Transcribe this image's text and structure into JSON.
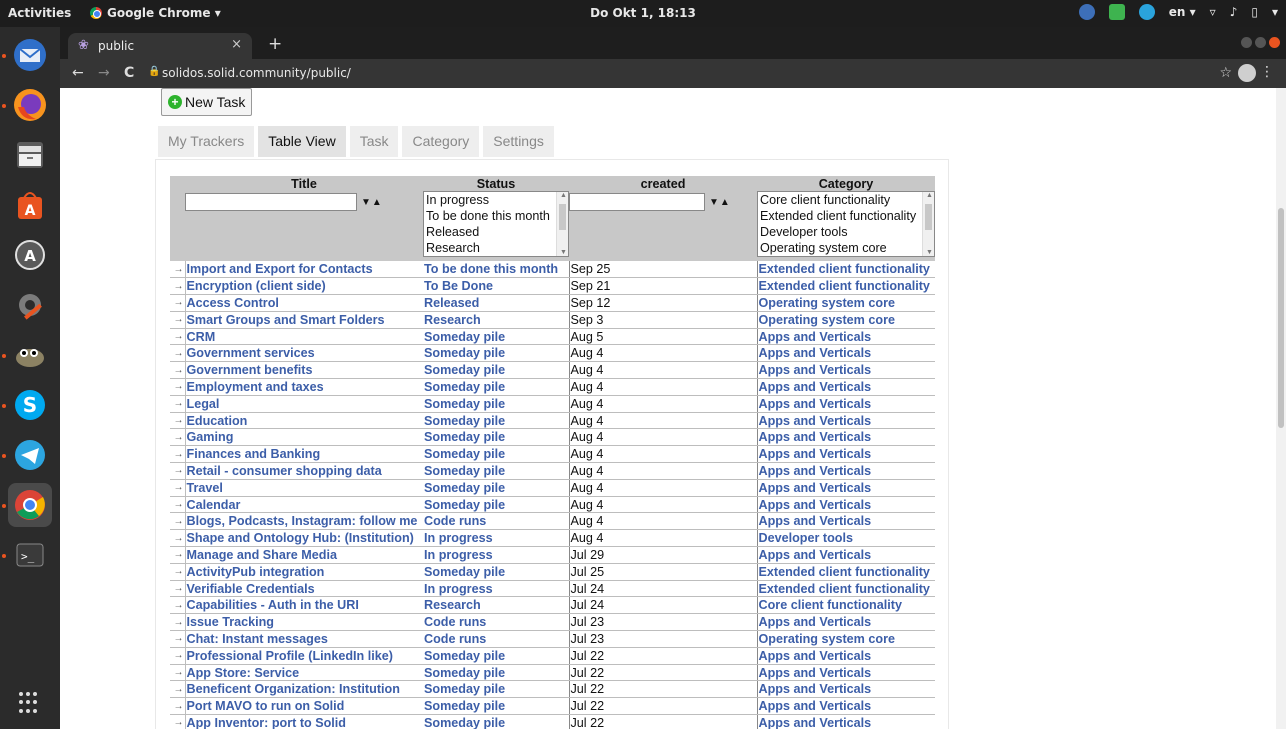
{
  "system": {
    "activities": "Activities",
    "app_menu": "Google Chrome ▾",
    "clock": "Do Okt  1, 18:13",
    "lang": "en ▾"
  },
  "browser": {
    "tab_title": "public",
    "tab_close": "×",
    "new_tab": "+",
    "url_host": "solidos.solid.community",
    "url_path": "/public/",
    "back": "←",
    "forward": "→",
    "reload": "C",
    "star": "☆",
    "menu": "⋮"
  },
  "page": {
    "new_task_label": "New Task",
    "tabs": [
      {
        "label": "My Trackers",
        "selected": false
      },
      {
        "label": "Table View",
        "selected": true
      },
      {
        "label": "Task",
        "selected": false
      },
      {
        "label": "Category",
        "selected": false
      },
      {
        "label": "Settings",
        "selected": false
      }
    ],
    "table": {
      "headers": [
        "Title",
        "Status",
        "created",
        "Category"
      ],
      "sort_arrows": "▼▲",
      "status_options": [
        "In progress",
        "To be done this month",
        "Released",
        "Research"
      ],
      "category_options": [
        "Core client functionality",
        "Extended client functionality",
        "Developer tools",
        "Operating system core"
      ],
      "row_arrow": "→",
      "rows": [
        {
          "title": "Import and Export for Contacts",
          "status": "To be done this month",
          "created": "Sep 25",
          "category": "Extended client functionality"
        },
        {
          "title": "Encryption (client side)",
          "status": "To Be Done",
          "created": "Sep 21",
          "category": "Extended client functionality"
        },
        {
          "title": "Access Control",
          "status": "Released",
          "created": "Sep 12",
          "category": "Operating system core"
        },
        {
          "title": "Smart Groups and Smart Folders",
          "status": "Research",
          "created": "Sep 3",
          "category": "Operating system core"
        },
        {
          "title": "CRM",
          "status": "Someday pile",
          "created": "Aug 5",
          "category": "Apps and Verticals"
        },
        {
          "title": "Government services",
          "status": "Someday pile",
          "created": "Aug 4",
          "category": "Apps and Verticals"
        },
        {
          "title": "Government benefits",
          "status": "Someday pile",
          "created": "Aug 4",
          "category": "Apps and Verticals"
        },
        {
          "title": "Employment and taxes",
          "status": "Someday pile",
          "created": "Aug 4",
          "category": "Apps and Verticals"
        },
        {
          "title": "Legal",
          "status": "Someday pile",
          "created": "Aug 4",
          "category": "Apps and Verticals"
        },
        {
          "title": "Education",
          "status": "Someday pile",
          "created": "Aug 4",
          "category": "Apps and Verticals"
        },
        {
          "title": "Gaming",
          "status": "Someday pile",
          "created": "Aug 4",
          "category": "Apps and Verticals"
        },
        {
          "title": "Finances and Banking",
          "status": "Someday pile",
          "created": "Aug 4",
          "category": "Apps and Verticals"
        },
        {
          "title": "Retail - consumer shopping data",
          "status": "Someday pile",
          "created": "Aug 4",
          "category": "Apps and Verticals"
        },
        {
          "title": "Travel",
          "status": "Someday pile",
          "created": "Aug 4",
          "category": "Apps and Verticals"
        },
        {
          "title": "Calendar",
          "status": "Someday pile",
          "created": "Aug 4",
          "category": "Apps and Verticals"
        },
        {
          "title": "Blogs, Podcasts, Instagram: follow me",
          "status": "Code runs",
          "created": "Aug 4",
          "category": "Apps and Verticals"
        },
        {
          "title": "Shape and Ontology Hub: (Institution)",
          "status": "In progress",
          "created": "Aug 4",
          "category": "Developer tools"
        },
        {
          "title": "Manage and Share Media",
          "status": "In progress",
          "created": "Jul 29",
          "category": "Apps and Verticals"
        },
        {
          "title": "ActivityPub integration",
          "status": "Someday pile",
          "created": "Jul 25",
          "category": "Extended client functionality"
        },
        {
          "title": "Verifiable Credentials",
          "status": "In progress",
          "created": "Jul 24",
          "category": "Extended client functionality"
        },
        {
          "title": "Capabilities - Auth in the URI",
          "status": "Research",
          "created": "Jul 24",
          "category": "Core client functionality"
        },
        {
          "title": "Issue Tracking",
          "status": "Code runs",
          "created": "Jul 23",
          "category": "Apps and Verticals"
        },
        {
          "title": "Chat: Instant messages",
          "status": "Code runs",
          "created": "Jul 23",
          "category": "Operating system core"
        },
        {
          "title": "Professional Profile (LinkedIn like)",
          "status": "Someday pile",
          "created": "Jul 22",
          "category": "Apps and Verticals"
        },
        {
          "title": "App Store: Service",
          "status": "Someday pile",
          "created": "Jul 22",
          "category": "Apps and Verticals"
        },
        {
          "title": "Beneficent Organization: Institution",
          "status": "Someday pile",
          "created": "Jul 22",
          "category": "Apps and Verticals"
        },
        {
          "title": "Port MAVO to run on Solid",
          "status": "Someday pile",
          "created": "Jul 22",
          "category": "Apps and Verticals"
        },
        {
          "title": "App Inventor: port to Solid",
          "status": "Someday pile",
          "created": "Jul 22",
          "category": "Apps and Verticals"
        }
      ]
    }
  },
  "dock": {
    "apps": [
      "thunderbird-icon",
      "firefox-icon",
      "files-icon",
      "software-center-icon",
      "updater-icon",
      "settings-tools-icon",
      "gimp-icon",
      "skype-icon",
      "telegram-icon",
      "chrome-icon",
      "terminal-icon"
    ]
  },
  "colors": {
    "link": "#3c5ea8",
    "header_bg": "#c8c8c8",
    "ubuntu_orange": "#e95420"
  }
}
